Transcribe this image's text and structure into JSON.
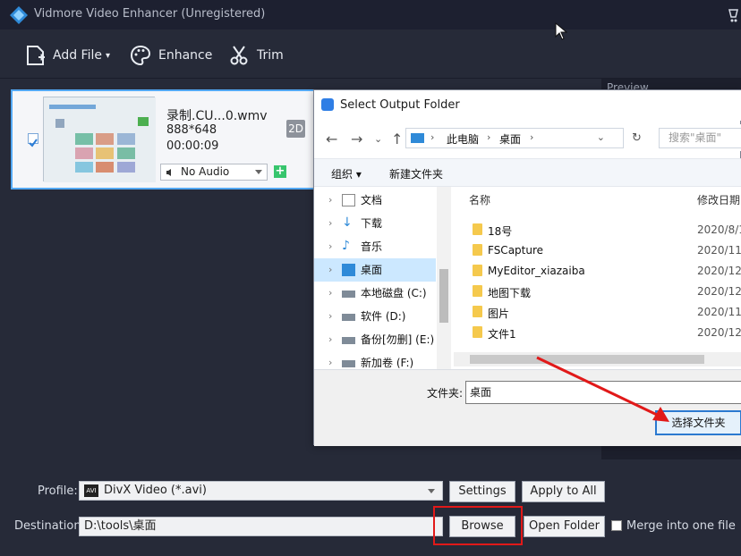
{
  "app": {
    "title": "Vidmore Video Enhancer (Unregistered)",
    "toolbar": {
      "add_file": "Add File",
      "enhance": "Enhance",
      "trim": "Trim"
    },
    "preview_label": "Preview",
    "file": {
      "name": "录制.CU...0.wmv",
      "resolution": "888*648",
      "duration": "00:00:09",
      "badge": "2D",
      "audio": "No Audio",
      "add_audio": "+"
    },
    "bottom": {
      "profile_label": "Profile:",
      "profile_value": "DivX Video (*.avi)",
      "settings": "Settings",
      "apply_all": "Apply to All",
      "destination_label": "Destination:",
      "destination_value": "D:\\tools\\桌面",
      "browse": "Browse",
      "open_folder": "Open Folder",
      "merge": "Merge into one file"
    }
  },
  "dialog": {
    "title": "Select Output Folder",
    "address": [
      "此电脑",
      "桌面"
    ],
    "search_placeholder": "搜索\"桌面\"",
    "organize": "组织 ▾",
    "new_folder": "新建文件夹",
    "tree": [
      {
        "label": "文档",
        "icon": "document-icon"
      },
      {
        "label": "下载",
        "icon": "download-icon"
      },
      {
        "label": "音乐",
        "icon": "music-icon"
      },
      {
        "label": "桌面",
        "icon": "desktop-icon",
        "selected": true
      },
      {
        "label": "本地磁盘 (C:)",
        "icon": "drive-icon"
      },
      {
        "label": "软件 (D:)",
        "icon": "drive-icon"
      },
      {
        "label": "备份[勿删] (E:)",
        "icon": "drive-icon"
      },
      {
        "label": "新加卷 (F:)",
        "icon": "drive-icon"
      }
    ],
    "columns": {
      "name": "名称",
      "date": "修改日期"
    },
    "files": [
      {
        "name": "18号",
        "date": "2020/8/1"
      },
      {
        "name": "FSCapture",
        "date": "2020/11/"
      },
      {
        "name": "MyEditor_xiazaiba",
        "date": "2020/12/"
      },
      {
        "name": "地图下载",
        "date": "2020/12/"
      },
      {
        "name": "图片",
        "date": "2020/11/"
      },
      {
        "name": "文件1",
        "date": "2020/12/"
      }
    ],
    "folder_label": "文件夹:",
    "folder_value": "桌面",
    "select_button": "选择文件夹"
  },
  "colors": {
    "accent": "#53a8f3",
    "highlight": "#e11919",
    "add": "#37c56d"
  }
}
